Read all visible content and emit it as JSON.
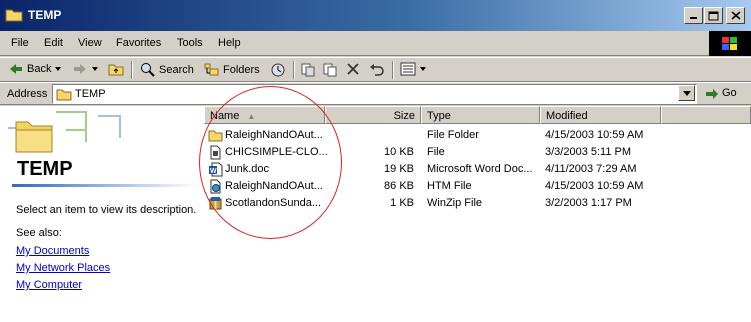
{
  "window": {
    "title": "TEMP"
  },
  "menu": [
    "File",
    "Edit",
    "View",
    "Favorites",
    "Tools",
    "Help"
  ],
  "toolbar": {
    "back": "Back",
    "search": "Search",
    "folders": "Folders"
  },
  "address": {
    "label": "Address",
    "value": "TEMP",
    "go": "Go"
  },
  "left": {
    "folder_title": "TEMP",
    "description": "Select an item to view its description.",
    "see_also": "See also:",
    "links": [
      "My Documents",
      "My Network Places",
      "My Computer"
    ]
  },
  "columns": {
    "name": "Name",
    "size": "Size",
    "type": "Type",
    "modified": "Modified"
  },
  "files": [
    {
      "icon": "folder-icon",
      "name": "RaleighNandOAut...",
      "size": "",
      "type": "File Folder",
      "modified": "4/15/2003 10:59 AM"
    },
    {
      "icon": "file-icon",
      "name": "CHICSIMPLE-CLO...",
      "size": "10 KB",
      "type": "File",
      "modified": "3/3/2003 5:11 PM"
    },
    {
      "icon": "word-doc-icon",
      "name": "Junk.doc",
      "size": "19 KB",
      "type": "Microsoft Word Doc...",
      "modified": "4/11/2003 7:29 AM"
    },
    {
      "icon": "html-file-icon",
      "name": "RaleighNandOAut...",
      "size": "86 KB",
      "type": "HTM File",
      "modified": "4/15/2003 10:59 AM"
    },
    {
      "icon": "winzip-icon",
      "name": "ScotlandonSunda...",
      "size": "1 KB",
      "type": "WinZip File",
      "modified": "3/2/2003 1:17 PM"
    }
  ]
}
